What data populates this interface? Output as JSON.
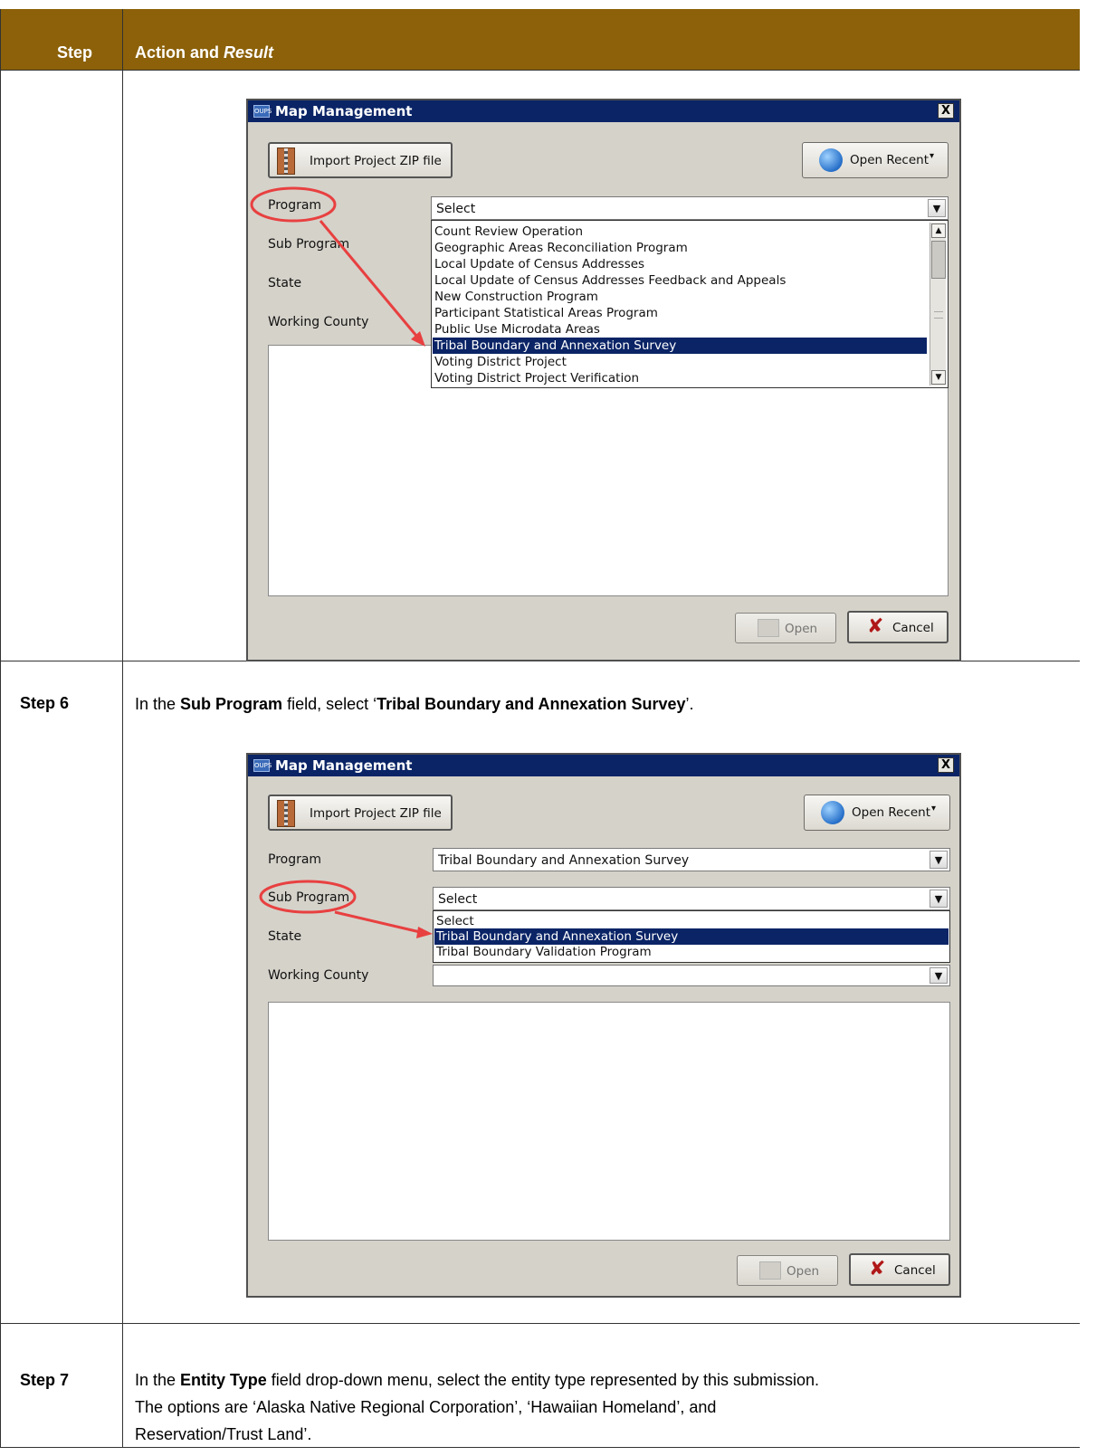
{
  "table": {
    "header": {
      "col1": "Step",
      "col2_prefix": "Action and ",
      "col2_italic": "Result"
    }
  },
  "dialog1": {
    "title": "Map Management",
    "logo": "OUPS",
    "close_label": "X",
    "import_button": "Import Project ZIP file",
    "open_recent_button": "Open Recent",
    "fields": {
      "program": "Program",
      "sub_program": "Sub Program",
      "state": "State",
      "working_county": "Working County"
    },
    "program_value": "Select",
    "program_options": [
      "Count Review Operation",
      "Geographic Areas Reconciliation Program",
      "Local Update of Census Addresses",
      "Local Update of Census Addresses Feedback and Appeals",
      "New Construction Program",
      "Participant Statistical Areas Program",
      "Public Use Microdata Areas",
      "Tribal Boundary and Annexation Survey",
      "Voting District Project",
      "Voting District Project Verification"
    ],
    "selected_option": "Tribal Boundary and Annexation Survey",
    "open_button": "Open",
    "cancel_button": "Cancel"
  },
  "step6": {
    "label": "Step 6",
    "text_1": "In the ",
    "bold_1": "Sub Program",
    "text_2": " field, select ‘",
    "bold_2": "Tribal Boundary and Annexation Survey",
    "text_3": "’."
  },
  "dialog2": {
    "title": "Map Management",
    "logo": "OUPS",
    "close_label": "X",
    "import_button": "Import Project ZIP file",
    "open_recent_button": "Open Recent",
    "fields": {
      "program": "Program",
      "sub_program": "Sub Program",
      "state": "State",
      "working_county": "Working County"
    },
    "program_value": "Tribal Boundary and Annexation Survey",
    "sub_program_value": "Select",
    "sub_program_options": [
      "Select",
      "Tribal Boundary and Annexation Survey",
      "Tribal Boundary Validation Program"
    ],
    "selected_option": "Tribal Boundary and Annexation Survey",
    "working_county_value": "",
    "open_button": "Open",
    "cancel_button": "Cancel"
  },
  "step7": {
    "label": "Step 7",
    "line1_a": "In the ",
    "line1_bold": "Entity Type",
    "line1_b": " field drop-down menu, select the entity type represented by this submission.",
    "line2": "The options are ‘Alaska Native Regional Corporation’, ‘Hawaiian Homeland’, and",
    "line3": "Reservation/Trust Land’."
  },
  "colors": {
    "header_bg": "#8c6109",
    "titlebar": "#0a2466",
    "annotation": "#e84040"
  }
}
